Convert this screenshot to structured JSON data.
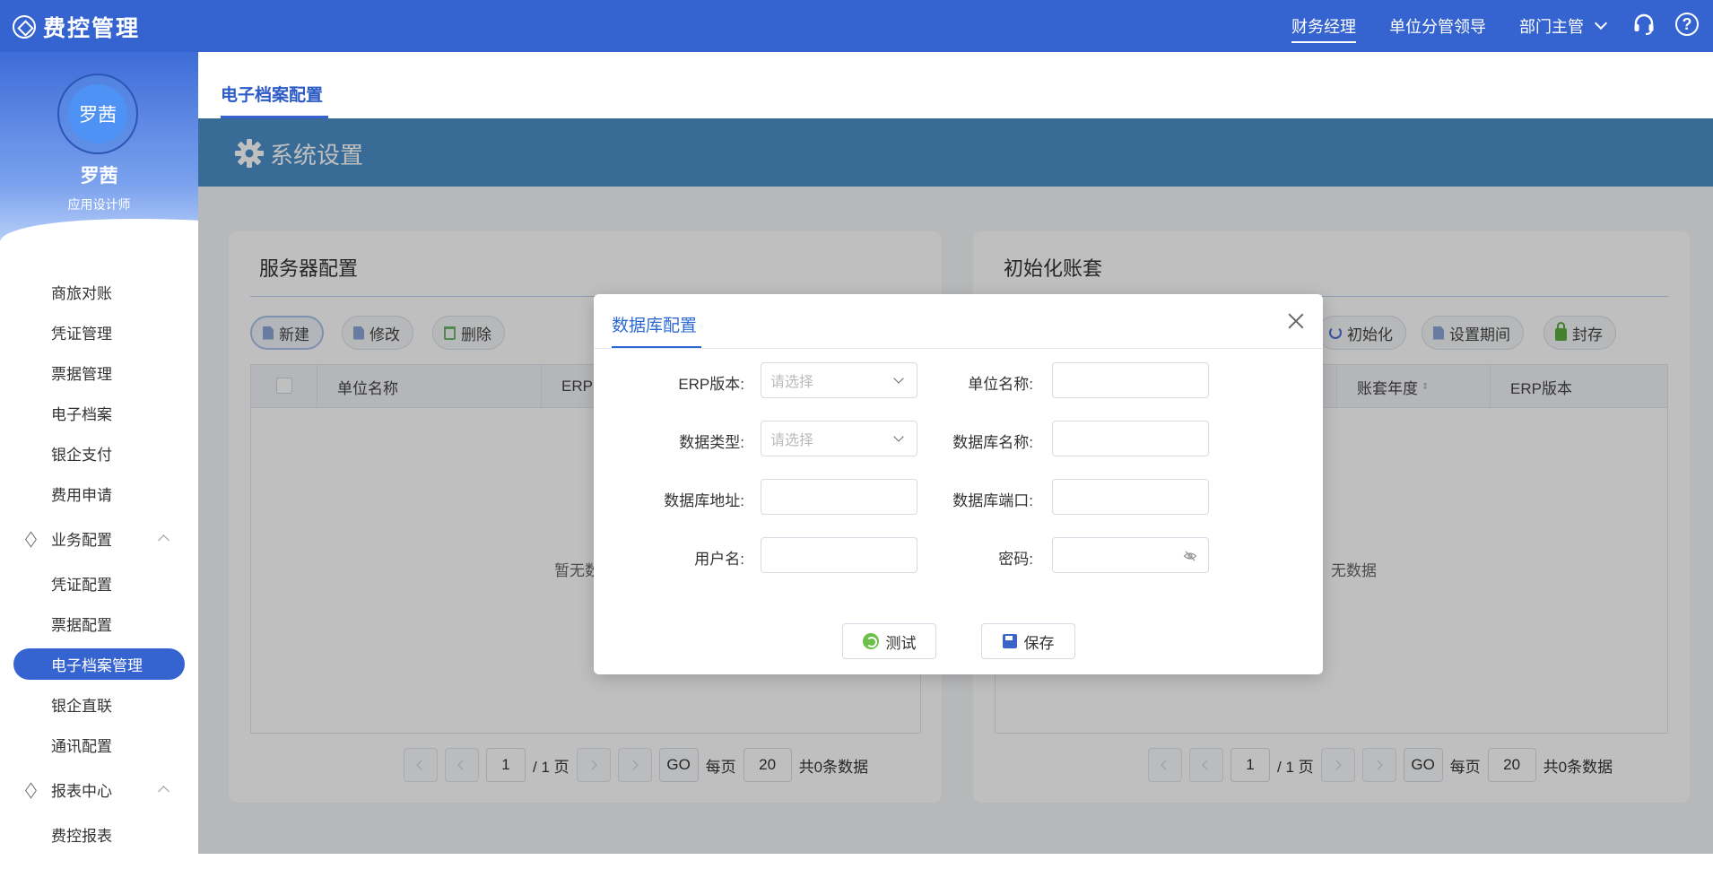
{
  "app": {
    "brand": "费控管理"
  },
  "topbar": {
    "roles": [
      "财务经理",
      "单位分管领导",
      "部门主管"
    ],
    "active_role": "财务经理",
    "help_glyph": "?",
    "icons": [
      "headset-icon",
      "help-icon"
    ]
  },
  "user": {
    "avatar_text": "罗茜",
    "name": "罗茜",
    "title": "应用设计师"
  },
  "sidebar": {
    "items_top": [
      "商旅对账",
      "凭证管理",
      "票据管理",
      "电子档案",
      "银企支付",
      "费用申请"
    ],
    "group_business": "业务配置",
    "items_business": [
      "凭证配置",
      "票据配置",
      "电子档案管理",
      "银企直联",
      "通讯配置"
    ],
    "active_item": "电子档案管理",
    "group_reports": "报表中心",
    "items_reports": [
      "费控报表"
    ]
  },
  "tabs": {
    "active": "电子档案配置"
  },
  "section": {
    "title": "系统设置"
  },
  "server_panel": {
    "title": "服务器配置",
    "buttons": {
      "new": "新建",
      "edit": "修改",
      "delete": "删除"
    },
    "columns": [
      "单位名称",
      "ERP"
    ],
    "empty": "暂无数"
  },
  "account_panel": {
    "title": "初始化账套",
    "buttons": {
      "init": "初始化",
      "period": "设置期间",
      "seal": "封存"
    },
    "columns": [
      "账套年度",
      "ERP版本"
    ],
    "empty": "无数据"
  },
  "pager": {
    "page": "1",
    "total_pages": "/ 1 页",
    "go": "GO",
    "per_page_label": "每页",
    "per_page": "20",
    "total": "共0条数据"
  },
  "modal": {
    "title": "数据库配置",
    "fields": {
      "erp_version": {
        "label": "ERP版本:",
        "placeholder": "请选择"
      },
      "unit_name": {
        "label": "单位名称:",
        "value": ""
      },
      "db_type": {
        "label": "数据类型:",
        "placeholder": "请选择"
      },
      "db_name": {
        "label": "数据库名称:",
        "value": ""
      },
      "db_address": {
        "label": "数据库地址:",
        "value": ""
      },
      "db_port": {
        "label": "数据库端口:",
        "value": ""
      },
      "username": {
        "label": "用户名:",
        "value": ""
      },
      "password": {
        "label": "密码:",
        "value": ""
      }
    },
    "buttons": {
      "test": "测试",
      "save": "保存"
    }
  },
  "colors": {
    "primary": "#3564d1",
    "header_band": "#4b91c9",
    "accent_link": "#2c69d4"
  }
}
